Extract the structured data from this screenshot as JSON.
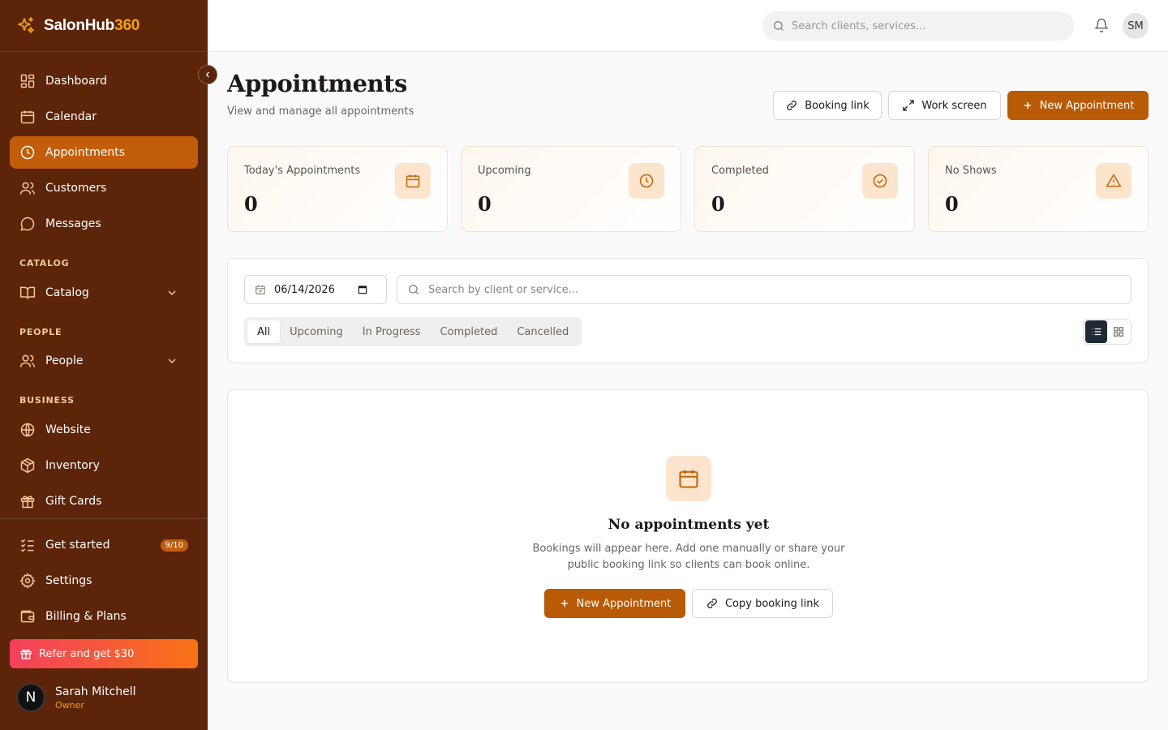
{
  "brand": {
    "name": "SalonHub",
    "suffix": "360"
  },
  "sidebar": {
    "main_items": [
      {
        "label": "Dashboard",
        "icon": "dashboard-icon"
      },
      {
        "label": "Calendar",
        "icon": "calendar-icon"
      },
      {
        "label": "Appointments",
        "icon": "clock-icon",
        "active": true
      },
      {
        "label": "Customers",
        "icon": "users-icon"
      },
      {
        "label": "Messages",
        "icon": "message-icon"
      }
    ],
    "catalog_section": "CATALOG",
    "catalog_item": "Catalog",
    "people_section": "PEOPLE",
    "people_item": "People",
    "business_section": "BUSINESS",
    "business_items": [
      {
        "label": "Website",
        "icon": "globe-icon"
      },
      {
        "label": "Inventory",
        "icon": "package-icon"
      },
      {
        "label": "Gift Cards",
        "icon": "gift-icon"
      }
    ],
    "get_started": {
      "label": "Get started",
      "badge": "9/10"
    },
    "settings": "Settings",
    "billing": "Billing & Plans",
    "refer": "Refer and get $30",
    "user": {
      "initial": "N",
      "name": "Sarah Mitchell",
      "role": "Owner"
    }
  },
  "topbar": {
    "search_placeholder": "Search clients, services...",
    "avatar_initials": "SM"
  },
  "page": {
    "title": "Appointments",
    "subtitle": "View and manage all appointments",
    "booking_link": "Booking link",
    "work_screen": "Work screen",
    "new_appointment": "New Appointment"
  },
  "stats": [
    {
      "label": "Today's Appointments",
      "value": "0",
      "icon": "calendar-icon"
    },
    {
      "label": "Upcoming",
      "value": "0",
      "icon": "clock-icon"
    },
    {
      "label": "Completed",
      "value": "0",
      "icon": "check-circle-icon"
    },
    {
      "label": "No Shows",
      "value": "0",
      "icon": "alert-triangle-icon"
    }
  ],
  "filters": {
    "date": "06/14/2026",
    "search_placeholder": "Search by client or service...",
    "tabs": [
      "All",
      "Upcoming",
      "In Progress",
      "Completed",
      "Cancelled"
    ],
    "active_tab": "All"
  },
  "empty": {
    "title": "No appointments yet",
    "description": "Bookings will appear here. Add one manually or share your public booking link so clients can book online.",
    "new_button": "New Appointment",
    "copy_button": "Copy booking link"
  },
  "colors": {
    "sidebar": "#5c2408",
    "accent": "#b95a06",
    "active_nav": "#c25d0a"
  }
}
